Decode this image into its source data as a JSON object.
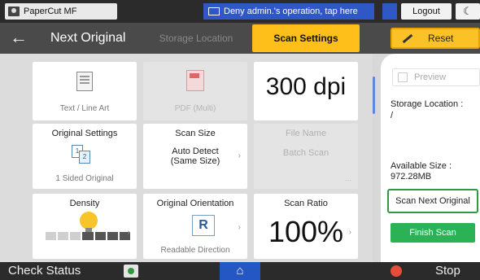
{
  "system_bar": {
    "user": "PaperCut MF",
    "notice": "Deny admin.'s operation, tap here",
    "logout": "Logout",
    "theme_glyph": "☾"
  },
  "header": {
    "back_glyph": "←",
    "title": "Next Original",
    "tabs": [
      {
        "label": "Storage Location",
        "active": false
      },
      {
        "label": "Scan Settings",
        "active": true
      }
    ],
    "reset": "Reset"
  },
  "tiles": {
    "scan_type": {
      "label": "Text / Line Art"
    },
    "file_type": {
      "label": "PDF (Multi)",
      "disabled": true
    },
    "resolution": {
      "value": "300 dpi"
    },
    "original_settings": {
      "title": "Original Settings",
      "label": "1 Sided Original",
      "icon_p1": "1",
      "icon_p2": "2"
    },
    "scan_size": {
      "title": "Scan Size",
      "value": "Auto Detect\n(Same Size)"
    },
    "file_name": {
      "title": "File Name",
      "value": "Batch Scan",
      "more": "...",
      "disabled": true
    },
    "density": {
      "title": "Density",
      "level": 4,
      "steps": 7
    },
    "orientation": {
      "title": "Original Orientation",
      "label": "Readable Direction",
      "icon_letter": "R"
    },
    "scan_ratio": {
      "title": "Scan Ratio",
      "value": "100%"
    }
  },
  "chevron": "›",
  "side_panel": {
    "preview": "Preview",
    "storage_label": "Storage Location :",
    "storage_value": "/",
    "available_label": "Available Size :",
    "available_value": "972.28MB",
    "scan_next": "Scan Next Original",
    "finish": "Finish Scan"
  },
  "bottom_bar": {
    "check_status": "Check Status",
    "home_glyph": "⌂",
    "stop": "Stop"
  },
  "colors": {
    "accent_yellow": "#ffbf1a",
    "finish_green": "#2bb255",
    "notice_blue": "#2f58c6"
  }
}
